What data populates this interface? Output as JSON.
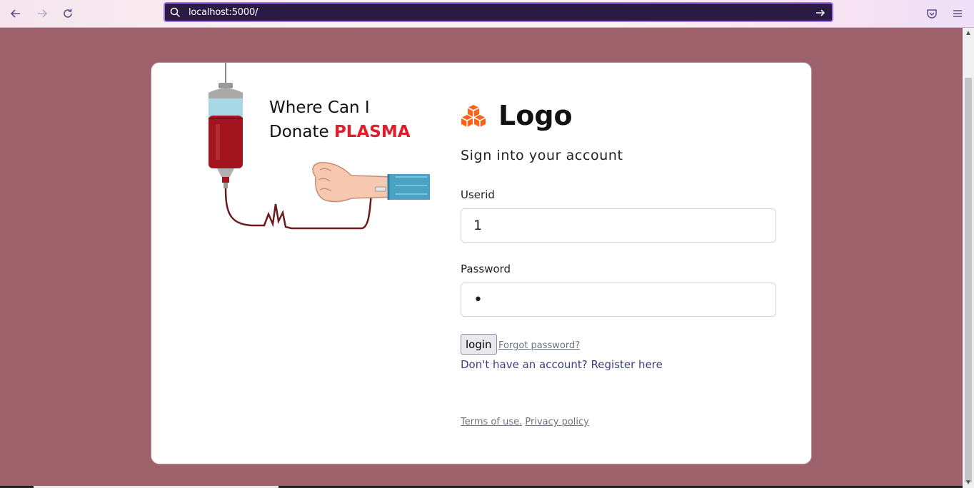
{
  "browser": {
    "url": "localhost:5000/",
    "icons": [
      "back-icon",
      "forward-icon",
      "reload-icon",
      "search-icon",
      "go-arrow-icon",
      "pocket-icon",
      "menu-icon"
    ]
  },
  "hero": {
    "tagline_line1": "Where Can I",
    "tagline_line2_prefix": "Donate",
    "tagline_line2_highlight": "PLASMA"
  },
  "form": {
    "logo_text": "Logo",
    "subtitle": "Sign into your account",
    "userid_label": "Userid",
    "userid_value": "1",
    "password_label": "Password",
    "password_value": "•",
    "login_label": "login",
    "forgot_label": "Forgot password?",
    "register_label": "Don't have an account? Register here",
    "terms_label": "Terms of use.",
    "privacy_label": "Privacy policy"
  },
  "colors": {
    "page_bg": "#9c616a",
    "accent_orange": "#ff6219",
    "plasma_red": "#e21d2b",
    "link_blue": "#393f81"
  }
}
